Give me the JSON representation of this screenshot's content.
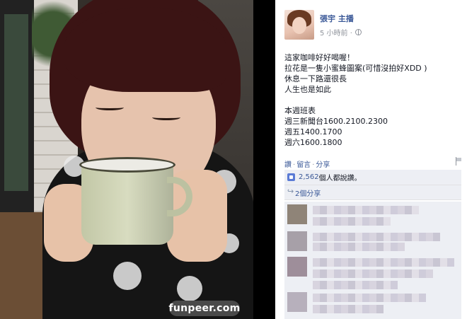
{
  "post": {
    "author": "張宇 主播",
    "time": "5 小時前 ·",
    "text_lines": [
      "這家咖啡好好喝喔！",
      "拉花是一隻小蜜蜂圖案(可惜沒拍好XDD )",
      "休息一下路還很長",
      "人生也是如此",
      "",
      "本週班表",
      "週三新聞台1600.2100.2300",
      "週五1400.1700",
      "週六1600.1800"
    ],
    "actions": {
      "like": "讚",
      "comment": "留言",
      "share": "分享"
    },
    "likes": {
      "count": "2,562",
      "suffix": " 個人都說讚。"
    },
    "shares": "2個分享"
  },
  "icons": {
    "privacy": "globe-icon",
    "flag": "flag-icon",
    "like": "thumbs-up-icon",
    "share": "share-arrow-icon"
  },
  "colors": {
    "link": "#3b5998",
    "panel_bg": "#ffffff",
    "box_bg": "#edeff4",
    "muted": "#90949c"
  },
  "watermark": "funpeer.com"
}
